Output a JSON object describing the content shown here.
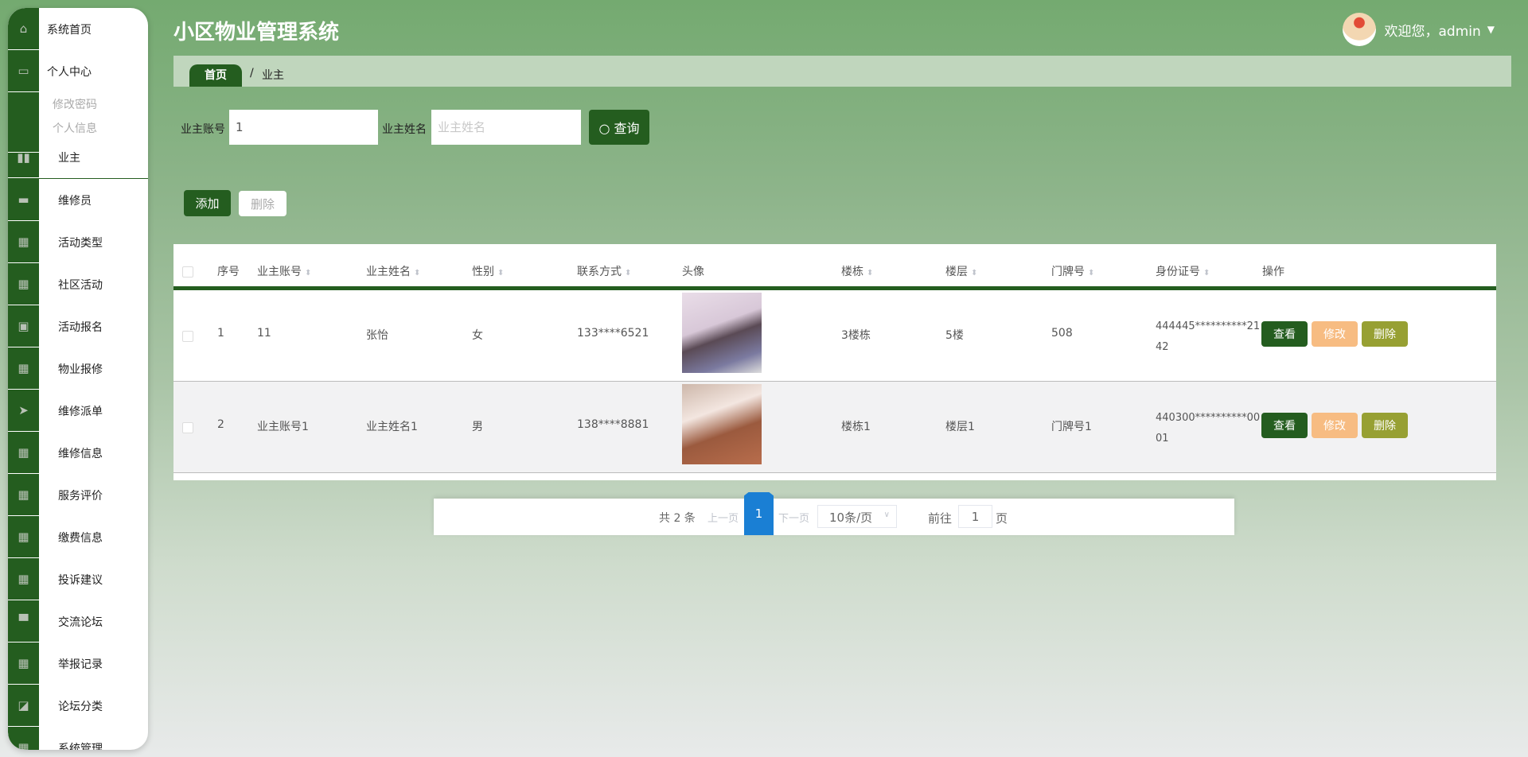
{
  "app": {
    "title": "小区物业管理系统",
    "welcome": "欢迎您，admin",
    "dropdown_icon": "caret-down-icon"
  },
  "sidebar": {
    "top": [
      {
        "label": "系统首页",
        "icon": "home-icon"
      },
      {
        "label": "个人中心",
        "icon": "id-card-icon"
      }
    ],
    "sub": [
      "修改密码",
      "个人信息"
    ],
    "items": [
      {
        "label": "业主",
        "icon": "book-icon",
        "active": true
      },
      {
        "label": "维修员",
        "icon": "briefcase-icon"
      },
      {
        "label": "活动类型",
        "icon": "grid-icon"
      },
      {
        "label": "社区活动",
        "icon": "apps-icon"
      },
      {
        "label": "活动报名",
        "icon": "clipboard-check-icon"
      },
      {
        "label": "物业报修",
        "icon": "grid-icon"
      },
      {
        "label": "维修派单",
        "icon": "paper-plane-icon"
      },
      {
        "label": "维修信息",
        "icon": "grid-icon"
      },
      {
        "label": "服务评价",
        "icon": "grid-icon"
      },
      {
        "label": "缴费信息",
        "icon": "grid-icon"
      },
      {
        "label": "投诉建议",
        "icon": "grid-icon"
      },
      {
        "label": "交流论坛",
        "icon": "monitor-icon"
      },
      {
        "label": "举报记录",
        "icon": "grid-icon"
      },
      {
        "label": "论坛分类",
        "icon": "chart-icon"
      },
      {
        "label": "系统管理",
        "icon": "grid-icon"
      }
    ]
  },
  "breadcrumb": {
    "home": "首页",
    "sep": "/",
    "current": "业主"
  },
  "search": {
    "account_label": "业主账号",
    "account_value": "1",
    "name_label": "业主姓名",
    "name_placeholder": "业主姓名",
    "query_label": "查询"
  },
  "actions": {
    "add": "添加",
    "delete": "删除"
  },
  "table": {
    "headers": [
      "序号",
      "业主账号",
      "业主姓名",
      "性别",
      "联系方式",
      "头像",
      "楼栋",
      "楼层",
      "门牌号",
      "身份证号",
      "操作"
    ],
    "rows": [
      {
        "no": "1",
        "account": "11",
        "name": "张怡",
        "gender": "女",
        "phone": "133****6521",
        "building": "3楼栋",
        "floor": "5楼",
        "door": "508",
        "id_line1": "444445**********21",
        "id_line2": "42"
      },
      {
        "no": "2",
        "account": "业主账号1",
        "name": "业主姓名1",
        "gender": "男",
        "phone": "138****8881",
        "building": "楼栋1",
        "floor": "楼层1",
        "door": "门牌号1",
        "id_line1": "440300**********00",
        "id_line2": "01"
      }
    ],
    "row_actions": {
      "view": "查看",
      "edit": "修改",
      "delete": "删除"
    }
  },
  "pagination": {
    "total": "共 2 条",
    "prev": "上一页",
    "current": "1",
    "next": "下一页",
    "page_size": "10条/页",
    "goto": "前往",
    "goto_value": "1",
    "page_unit": "页"
  },
  "colors": {
    "primary": "#245d1f",
    "edit": "#f7bc82",
    "delete": "#97a033",
    "page_active": "#1a7fd4"
  }
}
